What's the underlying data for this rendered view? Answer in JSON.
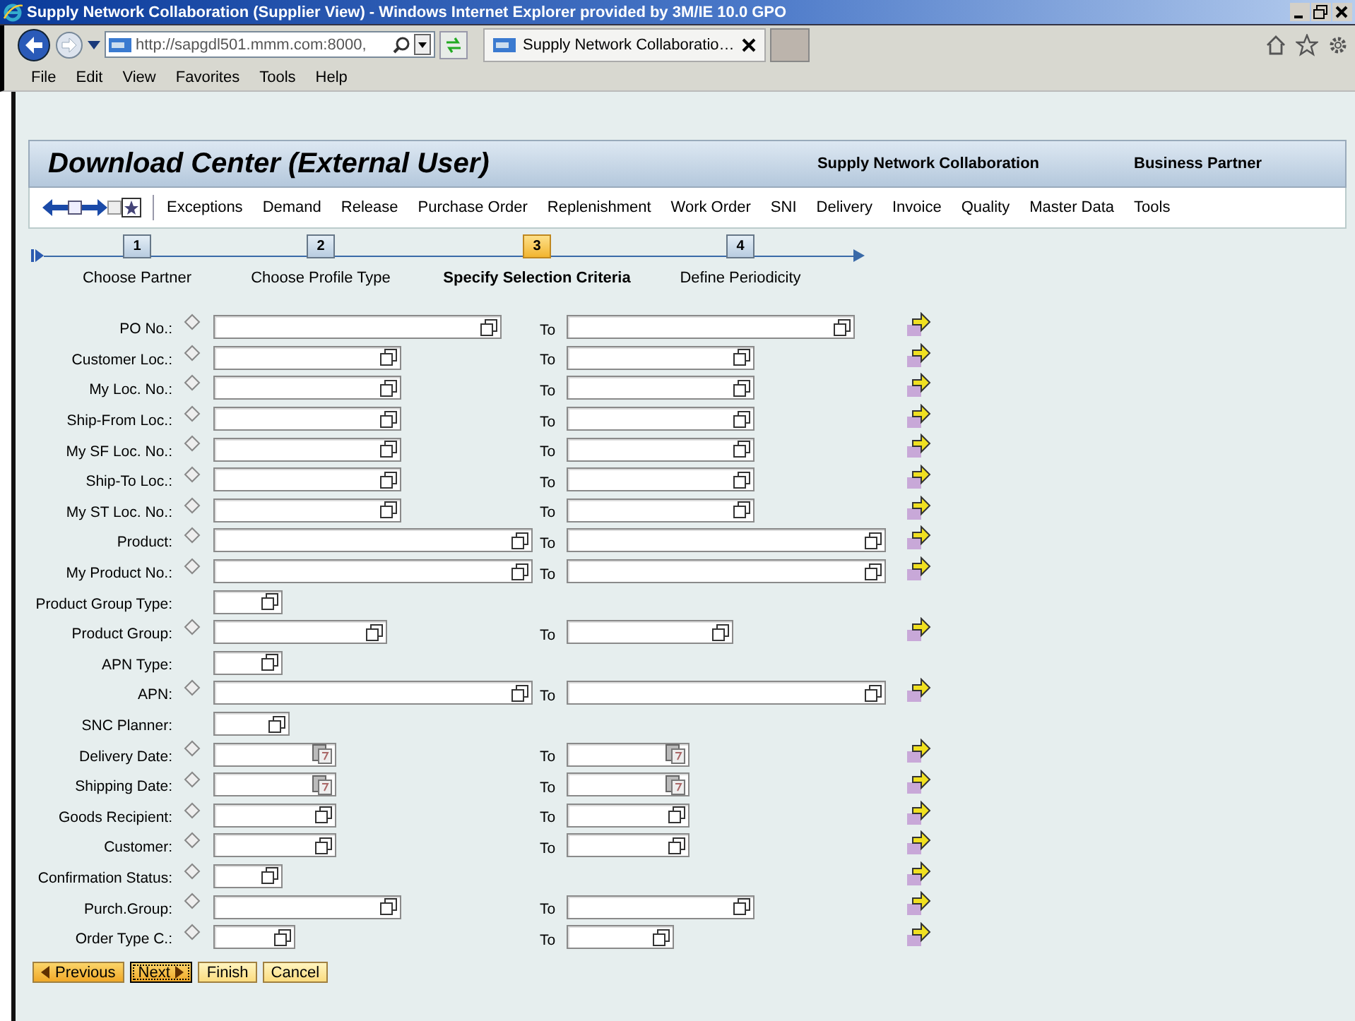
{
  "window": {
    "title": "Supply Network Collaboration (Supplier View) - Windows Internet Explorer provided by 3M/IE 10.0 GPO"
  },
  "address_bar": {
    "url": "http://sapgdl501.mmm.com:8000,"
  },
  "browser_tabs": [
    {
      "label": "Supply Network Collaboratio…",
      "selected": true
    }
  ],
  "menu_bar": [
    "File",
    "Edit",
    "View",
    "Favorites",
    "Tools",
    "Help"
  ],
  "header": {
    "title": "Download Center (External User)",
    "links": [
      "Supply Network Collaboration",
      "Business Partner"
    ]
  },
  "nav_menu": [
    "Exceptions",
    "Demand",
    "Release",
    "Purchase Order",
    "Replenishment",
    "Work Order",
    "SNI",
    "Delivery",
    "Invoice",
    "Quality",
    "Master Data",
    "Tools"
  ],
  "steps": [
    {
      "number": "1",
      "label": "Choose Partner",
      "selected": false
    },
    {
      "number": "2",
      "label": "Choose Profile Type",
      "selected": false
    },
    {
      "number": "3",
      "label": "Specify Selection Criteria",
      "selected": true
    },
    {
      "number": "4",
      "label": "Define Periodicity",
      "selected": false
    }
  ],
  "form_rows": [
    {
      "label": "PO No.:",
      "option": true,
      "kind": "text",
      "to": "To",
      "more": true
    },
    {
      "label": "Customer Loc.:",
      "option": true,
      "kind": "text",
      "to": "To",
      "more": true
    },
    {
      "label": "My Loc. No.:",
      "option": true,
      "kind": "text",
      "to": "To",
      "more": true
    },
    {
      "label": "Ship-From Loc.:",
      "option": true,
      "kind": "text",
      "to": "To",
      "more": true
    },
    {
      "label": "My SF Loc. No.:",
      "option": true,
      "kind": "text",
      "to": "To",
      "more": true
    },
    {
      "label": "Ship-To Loc.:",
      "option": true,
      "kind": "text",
      "to": "To",
      "more": true
    },
    {
      "label": "My ST Loc. No.:",
      "option": true,
      "kind": "text",
      "to": "To",
      "more": true
    },
    {
      "label": "Product:",
      "option": true,
      "kind": "text",
      "to": "To",
      "more": true
    },
    {
      "label": "My Product No.:",
      "option": true,
      "kind": "text",
      "to": "To",
      "more": true
    },
    {
      "label": "Product Group Type:",
      "option": false,
      "kind": "text",
      "more": false
    },
    {
      "label": "Product Group:",
      "option": true,
      "kind": "text",
      "to": "To",
      "more": true
    },
    {
      "label": "APN Type:",
      "option": false,
      "kind": "text",
      "more": false
    },
    {
      "label": "APN:",
      "option": true,
      "kind": "text",
      "to": "To",
      "more": true
    },
    {
      "label": "SNC Planner:",
      "option": false,
      "kind": "text",
      "more": false
    },
    {
      "label": "Delivery Date:",
      "option": true,
      "kind": "date",
      "to": "To",
      "more": true
    },
    {
      "label": "Shipping Date:",
      "option": true,
      "kind": "date",
      "to": "To",
      "more": true
    },
    {
      "label": "Goods Recipient:",
      "option": true,
      "kind": "text",
      "to": "To",
      "more": true
    },
    {
      "label": "Customer:",
      "option": true,
      "kind": "text",
      "to": "To",
      "more": true
    },
    {
      "label": "Confirmation Status:",
      "option": true,
      "kind": "text",
      "more": true
    },
    {
      "label": "Purch.Group:",
      "option": true,
      "kind": "text",
      "to": "To",
      "more": true
    },
    {
      "label": "Order Type C.:",
      "option": true,
      "kind": "text",
      "to": "To",
      "more": true
    }
  ],
  "buttons": [
    {
      "label": "Previous",
      "kind": "back",
      "focused": false
    },
    {
      "label": "Next",
      "kind": "forward",
      "focused": true
    },
    {
      "label": "Finish",
      "kind": "plain",
      "focused": false
    },
    {
      "label": "Cancel",
      "kind": "plain",
      "focused": false
    }
  ]
}
